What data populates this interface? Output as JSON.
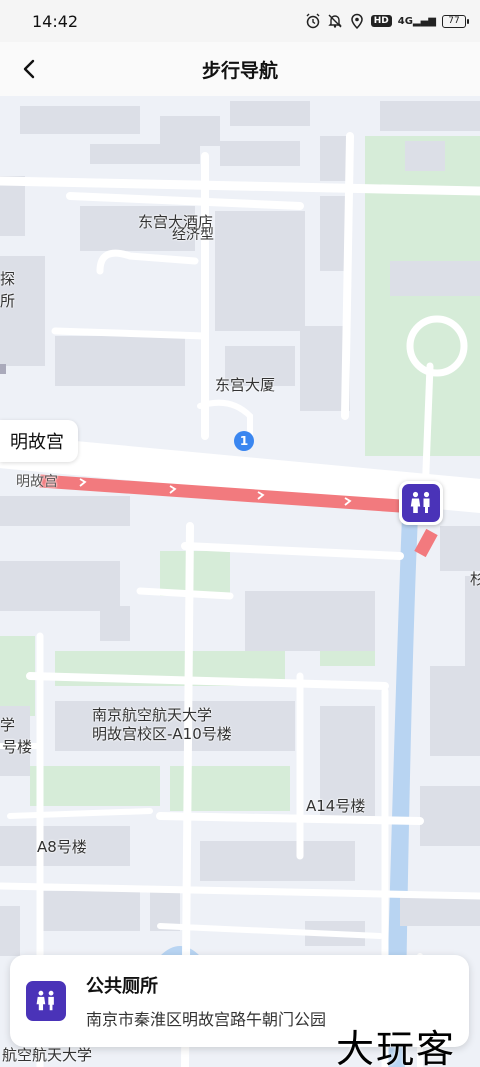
{
  "status_bar": {
    "time": "14:42",
    "icons": [
      "alarm-icon",
      "notification-icon",
      "location-icon",
      "hd-icon",
      "signal-icon",
      "battery-icon"
    ],
    "hd": "HD",
    "signal": "4G",
    "battery": "77"
  },
  "header": {
    "title": "步行导航"
  },
  "map": {
    "labels": {
      "l1": "东宫大酒店",
      "l2": "经济型",
      "l3": "探",
      "l4": "所",
      "l5": "东宫大厦",
      "l6": "明故宫",
      "l7": "南京航空航天大学",
      "l8": "明故宫校区-A10号楼",
      "l9": "学",
      "l10": "号楼",
      "l11": "A14号楼",
      "l12": "A8号楼",
      "l13": "航空航天大学",
      "l14": "杉"
    },
    "place_chip": "明故宫",
    "poi_badge": "1",
    "route_color": "#f27a7e",
    "poi_color": "#4a33b8"
  },
  "card": {
    "name": "公共厕所",
    "address": "南京市秦淮区明故宫路午朝门公园"
  },
  "watermark": "大玩客"
}
